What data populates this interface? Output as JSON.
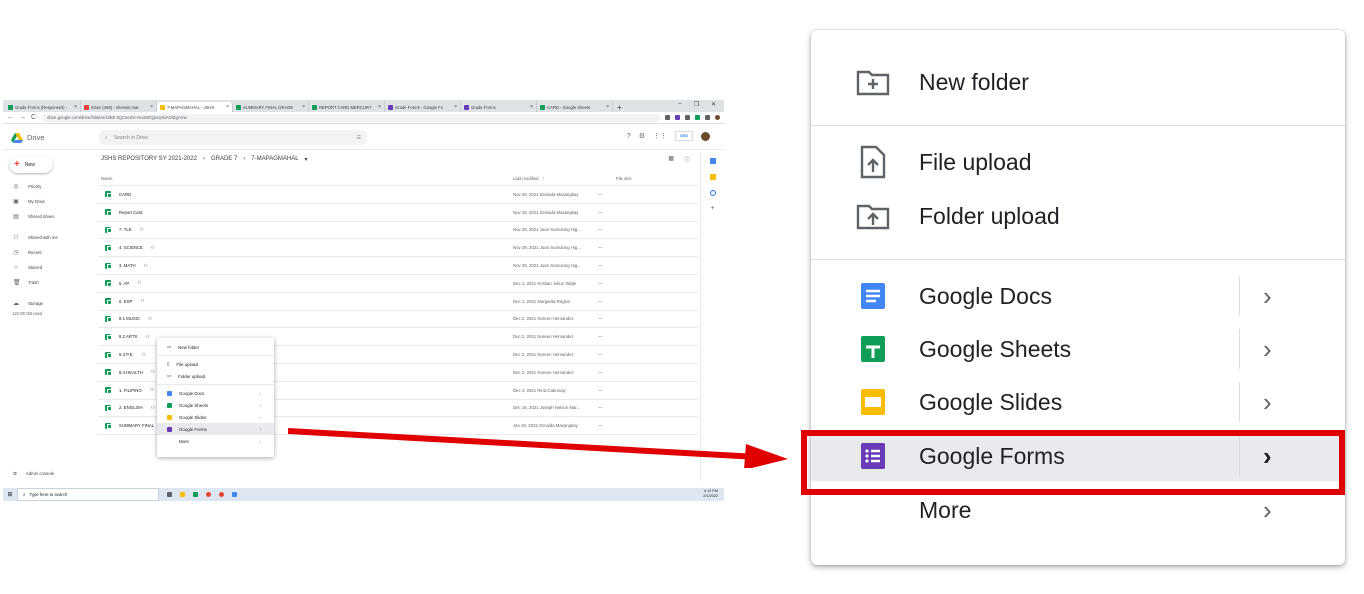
{
  "tabs": [
    {
      "label": "Grade Forms (Responses) - ",
      "color": "#0f9d58",
      "active": false
    },
    {
      "label": "Inbox (488) - sherwin.mar",
      "color": "#ea4335",
      "active": false
    },
    {
      "label": "7-MAPAGMAHAL - JSHS",
      "color": "#fbbc04",
      "active": true
    },
    {
      "label": "SUMMARY FINAL GRADE",
      "color": "#0f9d58",
      "active": false
    },
    {
      "label": "REPORT CARD MERCURY",
      "color": "#0f9d58",
      "active": false
    },
    {
      "label": "Grade Forms - Google Fo",
      "color": "#673ab7",
      "active": false
    },
    {
      "label": "Grade Forms",
      "color": "#673ab7",
      "active": false
    },
    {
      "label": "CARD - Google Sheets",
      "color": "#0f9d58",
      "active": false
    }
  ],
  "url": "drive.google.com/drive/folders/10kE-ZgCneZvr-Huo8ZQpvqAbADtZgAXw",
  "drive": {
    "app_name": "Drive",
    "search_placeholder": "Search in Drive",
    "new_label": "New",
    "profile_badge": "GSG",
    "sidebar": [
      {
        "icon": "priority-icon",
        "glyph": "◎",
        "label": "Priority"
      },
      {
        "icon": "my-drive-icon",
        "glyph": "▣",
        "label": "My Drive"
      },
      {
        "icon": "shared-drives-icon",
        "glyph": "▤",
        "label": "Shared drives"
      },
      {
        "icon": "shared-with-me-icon",
        "glyph": "⚇",
        "label": "Shared with me"
      },
      {
        "icon": "recent-icon",
        "glyph": "◷",
        "label": "Recent"
      },
      {
        "icon": "starred-icon",
        "glyph": "☆",
        "label": "Starred"
      },
      {
        "icon": "trash-icon",
        "glyph": "🗑",
        "label": "Trash"
      },
      {
        "icon": "storage-icon",
        "glyph": "☁",
        "label": "Storage"
      }
    ],
    "storage_used": "122.09 GB used",
    "admin_console": "Admin console",
    "breadcrumb": [
      "JSHS REPOSITORY SY 2021-2022",
      "GRADE 7",
      "7-MAPAGMAHAL"
    ],
    "columns": {
      "name": "Name",
      "modified": "Last modified",
      "size": "File size"
    },
    "files": [
      {
        "name": "CARD",
        "shared": false,
        "date": "Nov 29, 2021",
        "by": "Zenaida Masangkay",
        "size": "—"
      },
      {
        "name": "Report Card",
        "shared": false,
        "date": "Nov 29, 2021",
        "by": "Zenaida Masangkay",
        "size": "—"
      },
      {
        "name": "7. TLE",
        "shared": true,
        "date": "Nov 29, 2021",
        "by": "Juan Sumulong Hig...",
        "size": "—"
      },
      {
        "name": "4. SCIENCE",
        "shared": true,
        "date": "Nov 29, 2021",
        "by": "Juan Sumulong Hig...",
        "size": "—"
      },
      {
        "name": "3. MATH",
        "shared": true,
        "date": "Nov 29, 2021",
        "by": "Juan Sumulong Hig...",
        "size": "—"
      },
      {
        "name": "5. AP",
        "shared": true,
        "date": "Dec 1, 2021",
        "by": "Kristian Julius Tablje",
        "size": "—"
      },
      {
        "name": "6. ESP",
        "shared": true,
        "date": "Dec 1, 2021",
        "by": "Margarita Reglos",
        "size": "—"
      },
      {
        "name": "8.1 MUSIC",
        "shared": true,
        "date": "Dec 2, 2021",
        "by": "Noreen Hernandez",
        "size": "—"
      },
      {
        "name": "8.2 ARTS",
        "shared": true,
        "date": "Dec 2, 2021",
        "by": "Noreen Hernandez",
        "size": "—"
      },
      {
        "name": "8.3 P.E.",
        "shared": true,
        "date": "Dec 2, 2021",
        "by": "Noreen Hernandez",
        "size": "—"
      },
      {
        "name": "8.4 HEALTH",
        "shared": true,
        "date": "Dec 2, 2021",
        "by": "Noreen Hernandez",
        "size": "—"
      },
      {
        "name": "1. FILIPINO",
        "shared": true,
        "date": "Dec 4, 2021",
        "by": "Rina Cabumay",
        "size": "—"
      },
      {
        "name": "2. ENGLISH",
        "shared": true,
        "date": "Dec 19, 2021",
        "by": "Joseph Nelson Mar...",
        "size": "—"
      },
      {
        "name": "SUMMARY FINAL",
        "shared": false,
        "date": "Jan 26, 2022",
        "by": "Zenaida Masangkay",
        "size": "—"
      }
    ]
  },
  "taskbar": {
    "search_placeholder": "Type here to search",
    "time": "4:12 PM",
    "date": "2/1/2022"
  },
  "menu": {
    "new_folder": "New folder",
    "file_upload": "File upload",
    "folder_upload": "Folder upload",
    "apps": [
      {
        "label": "Google Docs",
        "color": "#4285f4",
        "icon": "google-docs-icon"
      },
      {
        "label": "Google Sheets",
        "color": "#0f9d58",
        "icon": "google-sheets-icon"
      },
      {
        "label": "Google Slides",
        "color": "#fbbc04",
        "icon": "google-slides-icon"
      },
      {
        "label": "Google Forms",
        "color": "#673ab7",
        "icon": "google-forms-icon"
      }
    ],
    "more": "More",
    "highlighted": "Google Forms"
  },
  "colors": {
    "highlight_box": "#e00000",
    "arrow": "#e00000"
  }
}
